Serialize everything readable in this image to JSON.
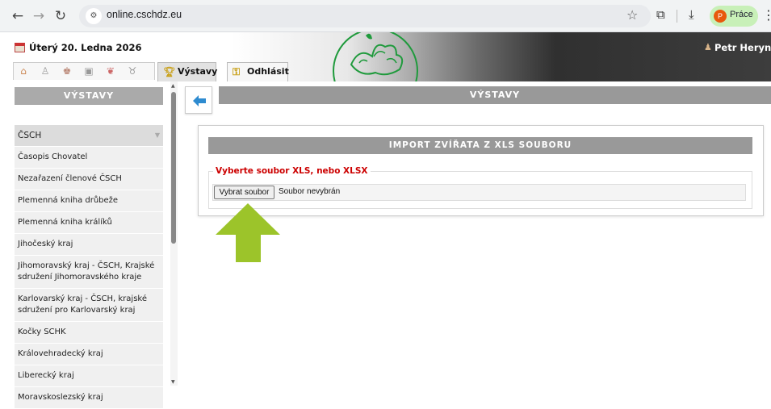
{
  "browser": {
    "url": "online.cschdz.eu",
    "back_icon": "arrow-left",
    "forward_icon": "arrow-right",
    "reload_icon": "reload",
    "profile_initial": "P",
    "profile_label": "Práce"
  },
  "header": {
    "date": "Úterý 20. Ledna 2026",
    "user": "Petr Heryne",
    "tabs": [
      {
        "label": "Výstavy",
        "icon": "trophy-icon",
        "active": true
      },
      {
        "label": "Odhlásit",
        "icon": "key-icon",
        "active": false
      }
    ],
    "tab_icons": [
      "home-icon",
      "users-icon",
      "people-icon",
      "book-icon",
      "rooster-icon",
      "rabbit-icon"
    ]
  },
  "sidebar": {
    "title": "VÝSTAVY",
    "group": "ČSCH",
    "items": [
      "Časopis Chovatel",
      "Nezařazení členové ČSCH",
      "Plemenná kniha drůbeže",
      "Plemenná kniha králíků",
      "Jihočeský kraj",
      "Jihomoravský kraj - ČSCH, Krajské sdružení Jihomoravského kraje",
      "Karlovarský kraj - ČSCH, krajské sdružení pro Karlovarský kraj",
      "Kočky SCHK",
      "Královehradecký kraj",
      "Liberecký kraj",
      "Moravskoslezský kraj"
    ]
  },
  "main": {
    "title": "VÝSTAVY",
    "panel_title": "IMPORT ZVÍŘATA Z XLS SOUBORU",
    "legend": "Vyberte soubor XLS, nebo XLSX",
    "file_button": "Vybrat soubor",
    "file_status": "Soubor nevybrán"
  },
  "colors": {
    "arrow": "#9cc42a",
    "legend": "#cc0000",
    "header_bar": "#999999",
    "back_arrow": "#2e8bd0"
  }
}
